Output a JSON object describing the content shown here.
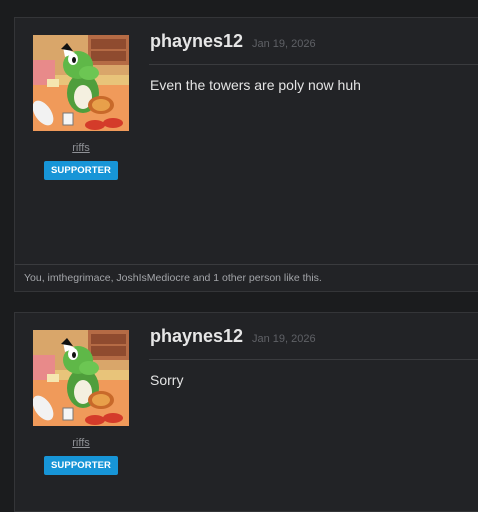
{
  "posts": [
    {
      "author": "phaynes12",
      "date": "Jan 19, 2026",
      "user_title": "riffs",
      "badge": "SUPPORTER",
      "message": "Even the towers are poly now huh",
      "likes": "You, imthegrimace, JoshIsMediocre and 1 other person like this."
    },
    {
      "author": "phaynes12",
      "date": "Jan 19, 2026",
      "user_title": "riffs",
      "badge": "SUPPORTER",
      "message": "Sorry"
    }
  ],
  "colors": {
    "background": "#1b1c1e",
    "post_background": "#222326",
    "badge": "#1795d7",
    "text": "#e4e4e4",
    "muted": "#8f9196"
  },
  "icons": [
    "avatar-yoshi-image"
  ]
}
